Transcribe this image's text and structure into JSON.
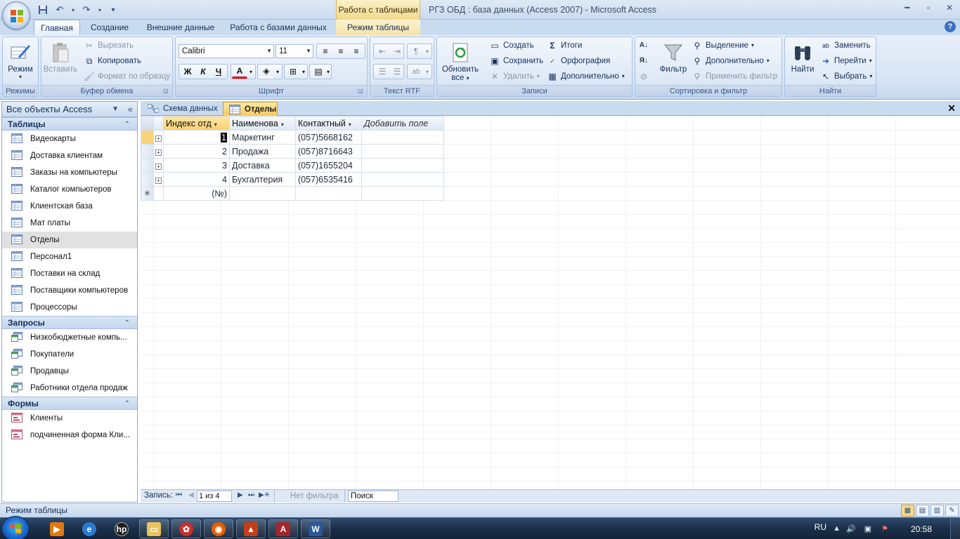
{
  "window": {
    "title": "РГЗ ОБД : база данных (Access 2007)  -  Microsoft Access",
    "context_tab_title": "Работа с таблицами"
  },
  "ribbon_tabs": [
    "Главная",
    "Создание",
    "Внешние данные",
    "Работа с базами данных",
    "Режим таблицы"
  ],
  "ribbon": {
    "groups": {
      "modes": "Режимы",
      "clipboard": "Буфер обмена",
      "font": "Шрифт",
      "rtf": "Текст RTF",
      "records": "Записи",
      "sort_filter": "Сортировка и фильтр",
      "find": "Найти"
    },
    "mode_button": "Режим",
    "paste": "Вставить",
    "cut": "Вырезать",
    "copy": "Копировать",
    "format_painter": "Формат по образцу",
    "font_name": "Calibri",
    "font_size": "11",
    "bold": "Ж",
    "italic": "К",
    "underline": "Ч",
    "refresh": "Обновить",
    "refresh_all": "все",
    "new": "Создать",
    "save": "Сохранить",
    "delete": "Удалить",
    "totals": "Итоги",
    "spelling": "Орфография",
    "more": "Дополнительно",
    "filter": "Фильтр",
    "selection": "Выделение",
    "advanced": "Дополнительно",
    "apply_filter": "Применить фильтр",
    "find_button": "Найти",
    "replace": "Заменить",
    "goto": "Перейти",
    "select": "Выбрать"
  },
  "nav": {
    "header": "Все объекты Access",
    "sections": [
      {
        "title": "Таблицы",
        "kind": "table",
        "items": [
          "Видеокарты",
          "Доставка клиентам",
          "Заказы на компьютеры",
          "Каталог компьютеров",
          "Клиентская база",
          "Мат платы",
          "Отделы",
          "Персонал1",
          "Поставки на склад",
          "Поставщики компьютеров",
          "Процессоры"
        ]
      },
      {
        "title": "Запросы",
        "kind": "query",
        "items": [
          "Низкобюджетные компь...",
          "Покупатели",
          "Продавцы",
          "Работники отдела продаж"
        ]
      },
      {
        "title": "Формы",
        "kind": "form",
        "items": [
          "Клиенты",
          "подчиненная форма Кли..."
        ]
      }
    ],
    "selected": "Отделы"
  },
  "doc_tabs": [
    "Схема данных",
    "Отделы"
  ],
  "table": {
    "columns": [
      "Индекс отд",
      "Наименова",
      "Контактный",
      "Добавить поле"
    ],
    "rows": [
      {
        "index": "1",
        "name": "Маркетинг",
        "contact": "(057)5668162"
      },
      {
        "index": "2",
        "name": "Продажа",
        "contact": "(057)8716643"
      },
      {
        "index": "3",
        "name": "Доставка",
        "contact": "(057)1655204"
      },
      {
        "index": "4",
        "name": "Бухгалтерия",
        "contact": "(057)6535416"
      }
    ],
    "new_row_placeholder": "(№)",
    "new_row_marker": "✳"
  },
  "record_nav": {
    "label": "Запись:",
    "position": "1 из 4",
    "no_filter": "Нет фильтра",
    "search": "Поиск"
  },
  "status": {
    "text": "Режим таблицы"
  },
  "taskbar": {
    "language": "RU",
    "clock": "20:58"
  },
  "colors": {
    "ribbon_bg": "#d7e4f4",
    "accent_tab": "#f7c95f",
    "taskbar": "#1b2f49"
  }
}
